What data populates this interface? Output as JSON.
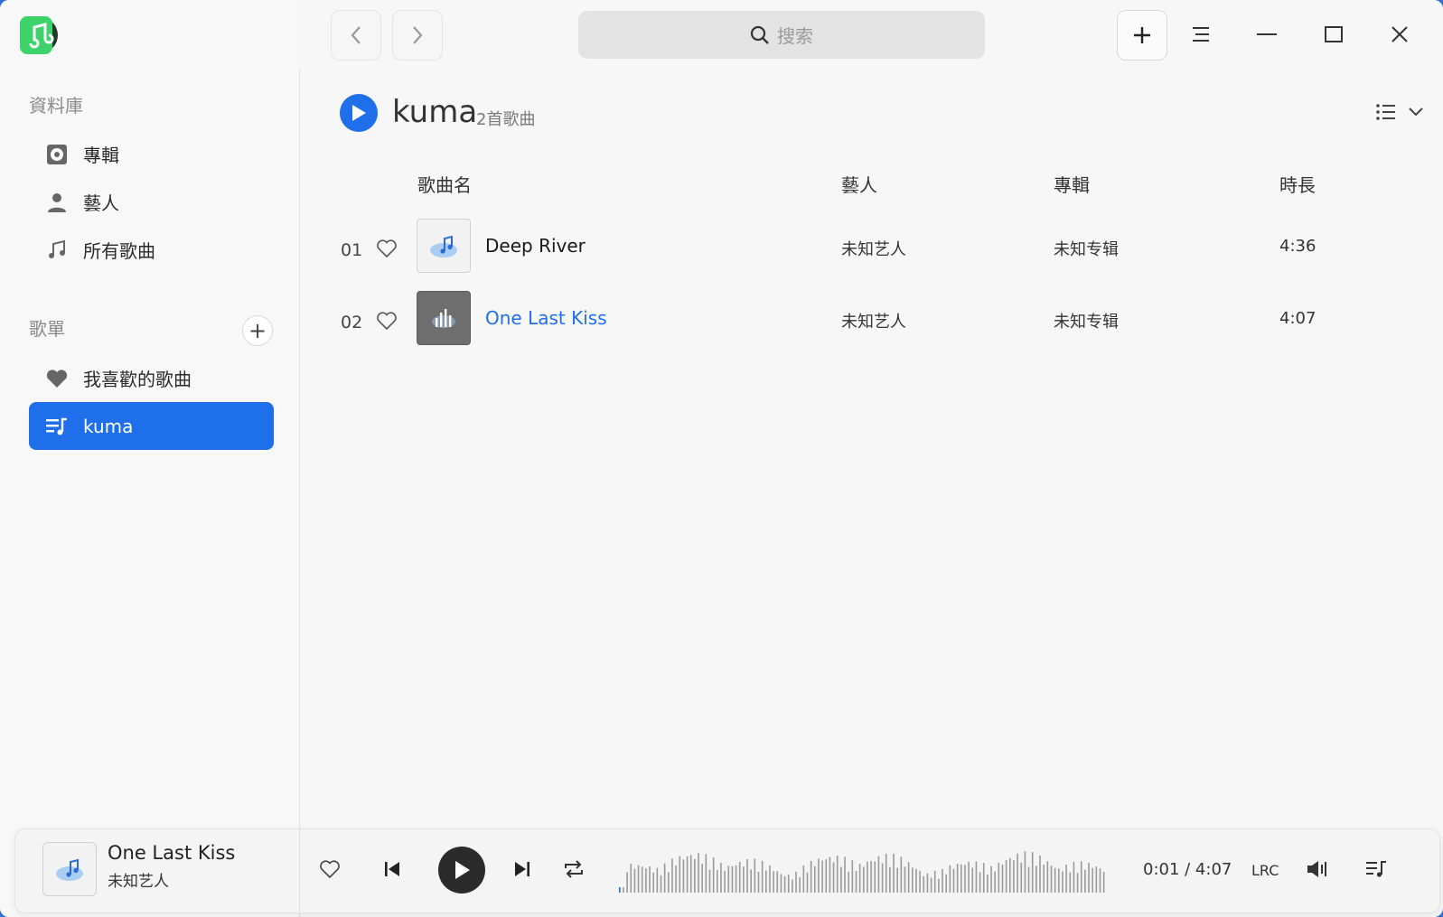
{
  "sidebar": {
    "library_title": "資料庫",
    "library_items": [
      {
        "label": "專輯",
        "icon": "album-disc-icon"
      },
      {
        "label": "藝人",
        "icon": "person-icon"
      },
      {
        "label": "所有歌曲",
        "icon": "music-note-icon"
      }
    ],
    "playlists_title": "歌單",
    "playlists": [
      {
        "label": "我喜歡的歌曲",
        "icon": "heart-icon"
      },
      {
        "label": "kuma",
        "icon": "playlist-icon",
        "active": true
      }
    ]
  },
  "topbar": {
    "search_placeholder": "搜索"
  },
  "playlist": {
    "name": "kuma",
    "count_label": "2首歌曲",
    "columns": {
      "title": "歌曲名",
      "artist": "藝人",
      "album": "專輯",
      "duration": "時長"
    },
    "songs": [
      {
        "num": "01",
        "title": "Deep River",
        "artist": "未知艺人",
        "album": "未知专辑",
        "duration": "4:36",
        "playing": false
      },
      {
        "num": "02",
        "title": "One Last Kiss",
        "artist": "未知艺人",
        "album": "未知专辑",
        "duration": "4:07",
        "playing": true
      }
    ]
  },
  "player": {
    "title": "One Last Kiss",
    "artist": "未知艺人",
    "elapsed": "0:01",
    "total": "4:07",
    "time_label": "0:01 / 4:07",
    "lyrics_label": "LRC",
    "progress_fraction": 0.004
  },
  "colors": {
    "accent": "#1f6fea",
    "logo_green": "#2ecc71"
  }
}
